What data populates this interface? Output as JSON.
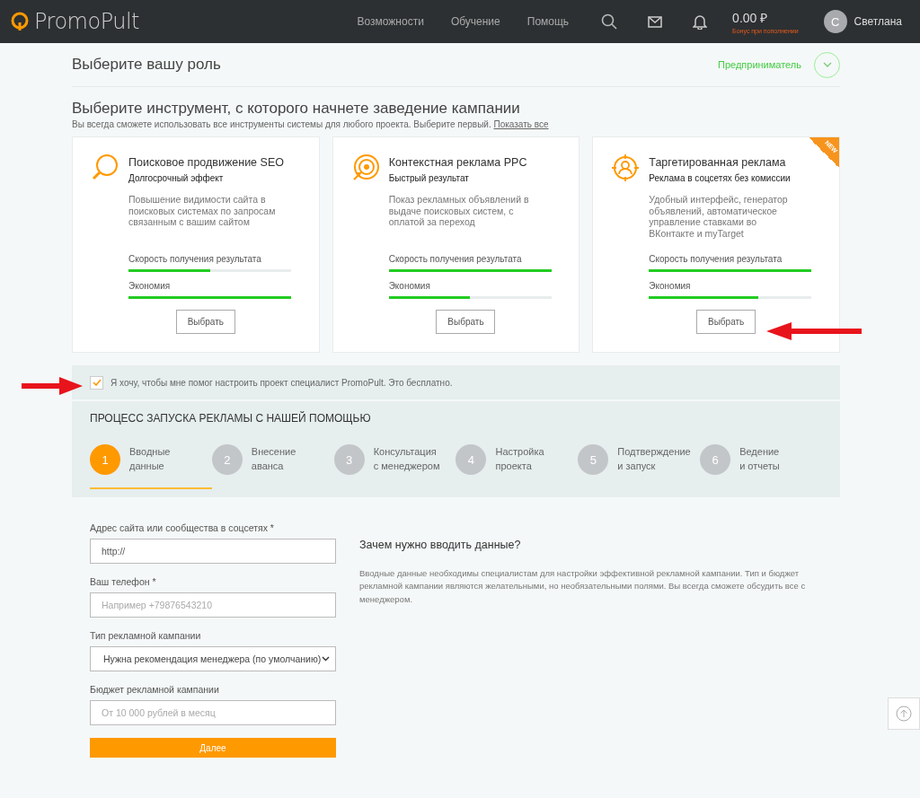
{
  "header": {
    "logo": "PromoPult",
    "nav": [
      "Возможности",
      "Обучение",
      "Помощь"
    ],
    "balance": "0.00 ₽",
    "bonus": "Бонус при пополнении",
    "avatar_letter": "С",
    "user": "Светлана"
  },
  "role": {
    "title": "Выберите вашу роль",
    "value": "Предприниматель"
  },
  "tools": {
    "title": "Выберите инструмент, с которого начнете заведение кампании",
    "subtitle": "Вы всегда сможете использовать все инструменты системы для любого проекта. Выберите первый.",
    "link": "Показать все",
    "cards": [
      {
        "kind": "search",
        "title": "Поисковое продвижение SEO",
        "subtitle": "Долгосрочный эффект",
        "text": "Повышение видимости сайта в поисковых системах по запросам связанным с вашим сайтом",
        "metrics": [
          {
            "label": "Скорость получения результата",
            "level": 0.5
          },
          {
            "label": "Экономия",
            "level": 1.0
          }
        ],
        "button": "Выбрать"
      },
      {
        "kind": "target",
        "title": "Контекстная реклама PPC",
        "subtitle": "Быстрый результат",
        "text": "Показ рекламных объявлений в выдаче поисковых систем, с оплатой за переход",
        "metrics": [
          {
            "label": "Скорость получения результата",
            "level": 1.0
          },
          {
            "label": "Экономия",
            "level": 0.5
          }
        ],
        "button": "Выбрать"
      },
      {
        "kind": "person",
        "title": "Таргетированная реклама",
        "subtitle": "Реклама в соцсетях без комиссии",
        "text": "Удобный интерфейс, генератор объявлений, автоматическое управление ставками во ВКонтакте и myTarget",
        "metrics": [
          {
            "label": "Скорость получения результата",
            "level": 1.0
          },
          {
            "label": "Экономия",
            "level": 0.67
          }
        ],
        "button": "Выбрать",
        "badge": "NEW"
      }
    ]
  },
  "help": {
    "checked": true,
    "label": "Я хочу, чтобы мне помог настроить проект специалист PromoPult. Это бесплатно."
  },
  "process": {
    "title": "ПРОЦЕСС ЗАПУСКА РЕКЛАМЫ С НАШЕЙ ПОМОЩЬЮ",
    "steps": [
      {
        "number": "1",
        "line1": "Вводные",
        "line2": "данные",
        "selected": true
      },
      {
        "number": "2",
        "line1": "Внесение",
        "line2": "аванса",
        "selected": false
      },
      {
        "number": "3",
        "line1": "Консультация",
        "line2": "с менеджером",
        "selected": false
      },
      {
        "number": "4",
        "line1": "Настройка",
        "line2": "проекта",
        "selected": false
      },
      {
        "number": "5",
        "line1": "Подтверждение",
        "line2": "и запуск",
        "selected": false
      },
      {
        "number": "6",
        "line1": "Ведение",
        "line2": "и отчеты",
        "selected": false
      }
    ]
  },
  "form": {
    "fields": [
      {
        "kind": "input",
        "label": "Адрес сайта или сообщества в соцсетях *",
        "value": "http://"
      },
      {
        "kind": "input",
        "label": "Ваш телефон *",
        "placeholder": "Например +79876543210"
      },
      {
        "kind": "select",
        "label": "Тип рекламной кампании",
        "value": "Нужна рекомендация менеджера (по умолчанию)"
      },
      {
        "kind": "input",
        "label": "Бюджет рекламной кампании",
        "placeholder": "От 10 000 рублей в месяц"
      }
    ],
    "submit": "Далее"
  },
  "info": {
    "title": "Зачем нужно вводить данные?",
    "text": "Вводные данные необходимы специалистам для настройки эффективной рекламной кампании. Тип и бюджет рекламной кампании являются желательными, но необязательными полями. Вы всегда сможете обсудить все с менеджером."
  }
}
